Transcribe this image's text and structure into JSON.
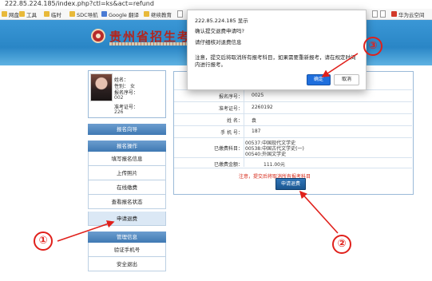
{
  "browser": {
    "url": "222.85.224.185/index.php?ctl=ks&act=refund",
    "bookmarks": [
      "网盘",
      "工具",
      "临时",
      "SDC导航",
      "Google 翻译",
      "继续教育",
      "",
      "华为云空间"
    ]
  },
  "banner": {
    "title": "贵州省招生考试院"
  },
  "profile": {
    "name_label": "姓名：",
    "name_value": "",
    "gender_label": "性别：",
    "gender_value": "女",
    "reg_label": "报名序号：",
    "reg_value": "002",
    "ticket_label": "准考证号：",
    "ticket_value": "226"
  },
  "menu": {
    "header1": "报名向导",
    "header2": "报名操作",
    "items": [
      "填写报名信息",
      "上传照片",
      "在线缴费",
      "查看报名状态",
      "申请退费"
    ],
    "header3": "管理信息",
    "items2": [
      "验证手机号",
      "安全退出"
    ]
  },
  "info": {
    "rows": [
      {
        "label": "报名序号：",
        "value": "0025"
      },
      {
        "label": "准考证号：",
        "value": "2260192"
      },
      {
        "label": "姓    名：",
        "value": "袁"
      },
      {
        "label": "手  机  号：",
        "value": "187"
      },
      {
        "label": "已缴费科目：",
        "value": "00537:中国现代文学史"
      },
      {
        "label": "",
        "value": "00538:中国古代文学史(一)"
      },
      {
        "label": "",
        "value": "00540:外国文学史"
      },
      {
        "label": "已缴费金额：",
        "value": "111.00元"
      }
    ],
    "notice": "注意，提交后将取消所有报考科目",
    "apply_button": "申请退费"
  },
  "dialog": {
    "title": "222.85.224.185 显示",
    "question": "确认提交退费申请吗?",
    "check": "请仔细核对退费信息",
    "note": "注意，提交后将取消所有报考科目，如果需要重新报考，请在规定时间内进行报考。",
    "ok": "确定",
    "cancel": "取消"
  },
  "steps": [
    "①",
    "②",
    "③"
  ],
  "colors": {
    "accent": "#1f6fdd",
    "marker": "#e0201b",
    "banner": "#2a86c6",
    "notice": "#d62a1a"
  }
}
